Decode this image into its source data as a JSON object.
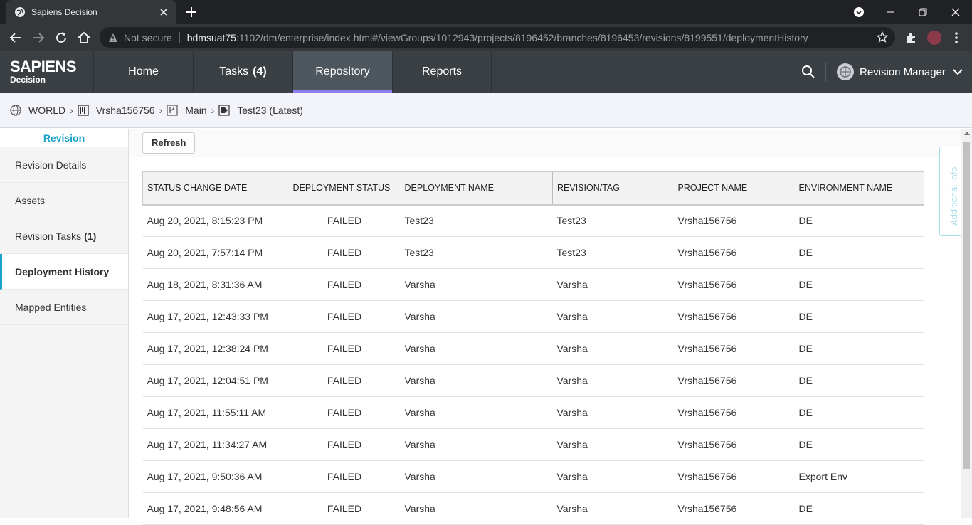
{
  "browser": {
    "tab_title": "Sapiens Decision",
    "not_secure": "Not secure",
    "url_host": "bdmsuat75",
    "url_rest": ":1102/dm/enterprise/index.html#/viewGroups/1012943/projects/8196452/branches/8196453/revisions/8199551/deploymentHistory"
  },
  "app": {
    "logo_line1": "SAPIENS",
    "logo_line2": "Decision",
    "nav": [
      {
        "label": "Home",
        "count": ""
      },
      {
        "label": "Tasks",
        "count": "(4)"
      },
      {
        "label": "Repository",
        "count": ""
      },
      {
        "label": "Reports",
        "count": ""
      }
    ],
    "active_nav": "Repository",
    "user": "Revision Manager"
  },
  "breadcrumb": {
    "world": "WORLD",
    "project": "Vrsha156756",
    "branch": "Main",
    "revision": "Test23 (Latest)"
  },
  "sidebar": {
    "header": "Revision",
    "items": [
      {
        "label": "Revision Details",
        "count": ""
      },
      {
        "label": "Assets",
        "count": ""
      },
      {
        "label": "Revision Tasks",
        "count": "(1)"
      },
      {
        "label": "Deployment History",
        "count": ""
      },
      {
        "label": "Mapped Entities",
        "count": ""
      }
    ],
    "active": "Deployment History"
  },
  "toolbar": {
    "refresh_label": "Refresh"
  },
  "additional_info": "Additional Info",
  "table": {
    "columns": [
      "STATUS CHANGE DATE",
      "DEPLOYMENT STATUS",
      "DEPLOYMENT NAME",
      "REVISION/TAG",
      "PROJECT NAME",
      "ENVIRONMENT NAME"
    ],
    "rows": [
      [
        "Aug 20, 2021, 8:15:23 PM",
        "FAILED",
        "Test23",
        "Test23",
        "Vrsha156756",
        "DE"
      ],
      [
        "Aug 20, 2021, 7:57:14 PM",
        "FAILED",
        "Test23",
        "Test23",
        "Vrsha156756",
        "DE"
      ],
      [
        "Aug 18, 2021, 8:31:36 AM",
        "FAILED",
        "Varsha",
        "Varsha",
        "Vrsha156756",
        "DE"
      ],
      [
        "Aug 17, 2021, 12:43:33 PM",
        "FAILED",
        "Varsha",
        "Varsha",
        "Vrsha156756",
        "DE"
      ],
      [
        "Aug 17, 2021, 12:38:24 PM",
        "FAILED",
        "Varsha",
        "Varsha",
        "Vrsha156756",
        "DE"
      ],
      [
        "Aug 17, 2021, 12:04:51 PM",
        "FAILED",
        "Varsha",
        "Varsha",
        "Vrsha156756",
        "DE"
      ],
      [
        "Aug 17, 2021, 11:55:11 AM",
        "FAILED",
        "Varsha",
        "Varsha",
        "Vrsha156756",
        "DE"
      ],
      [
        "Aug 17, 2021, 11:34:27 AM",
        "FAILED",
        "Varsha",
        "Varsha",
        "Vrsha156756",
        "DE"
      ],
      [
        "Aug 17, 2021, 9:50:36 AM",
        "FAILED",
        "Varsha",
        "Varsha",
        "Vrsha156756",
        "Export Env"
      ],
      [
        "Aug 17, 2021, 9:48:56 AM",
        "FAILED",
        "Varsha",
        "Varsha",
        "Vrsha156756",
        "DE"
      ]
    ]
  },
  "colors": {
    "accent": "#1aa3c9",
    "active_tab_underline": "#8f7ff0",
    "header_bg": "#3a3f44"
  }
}
